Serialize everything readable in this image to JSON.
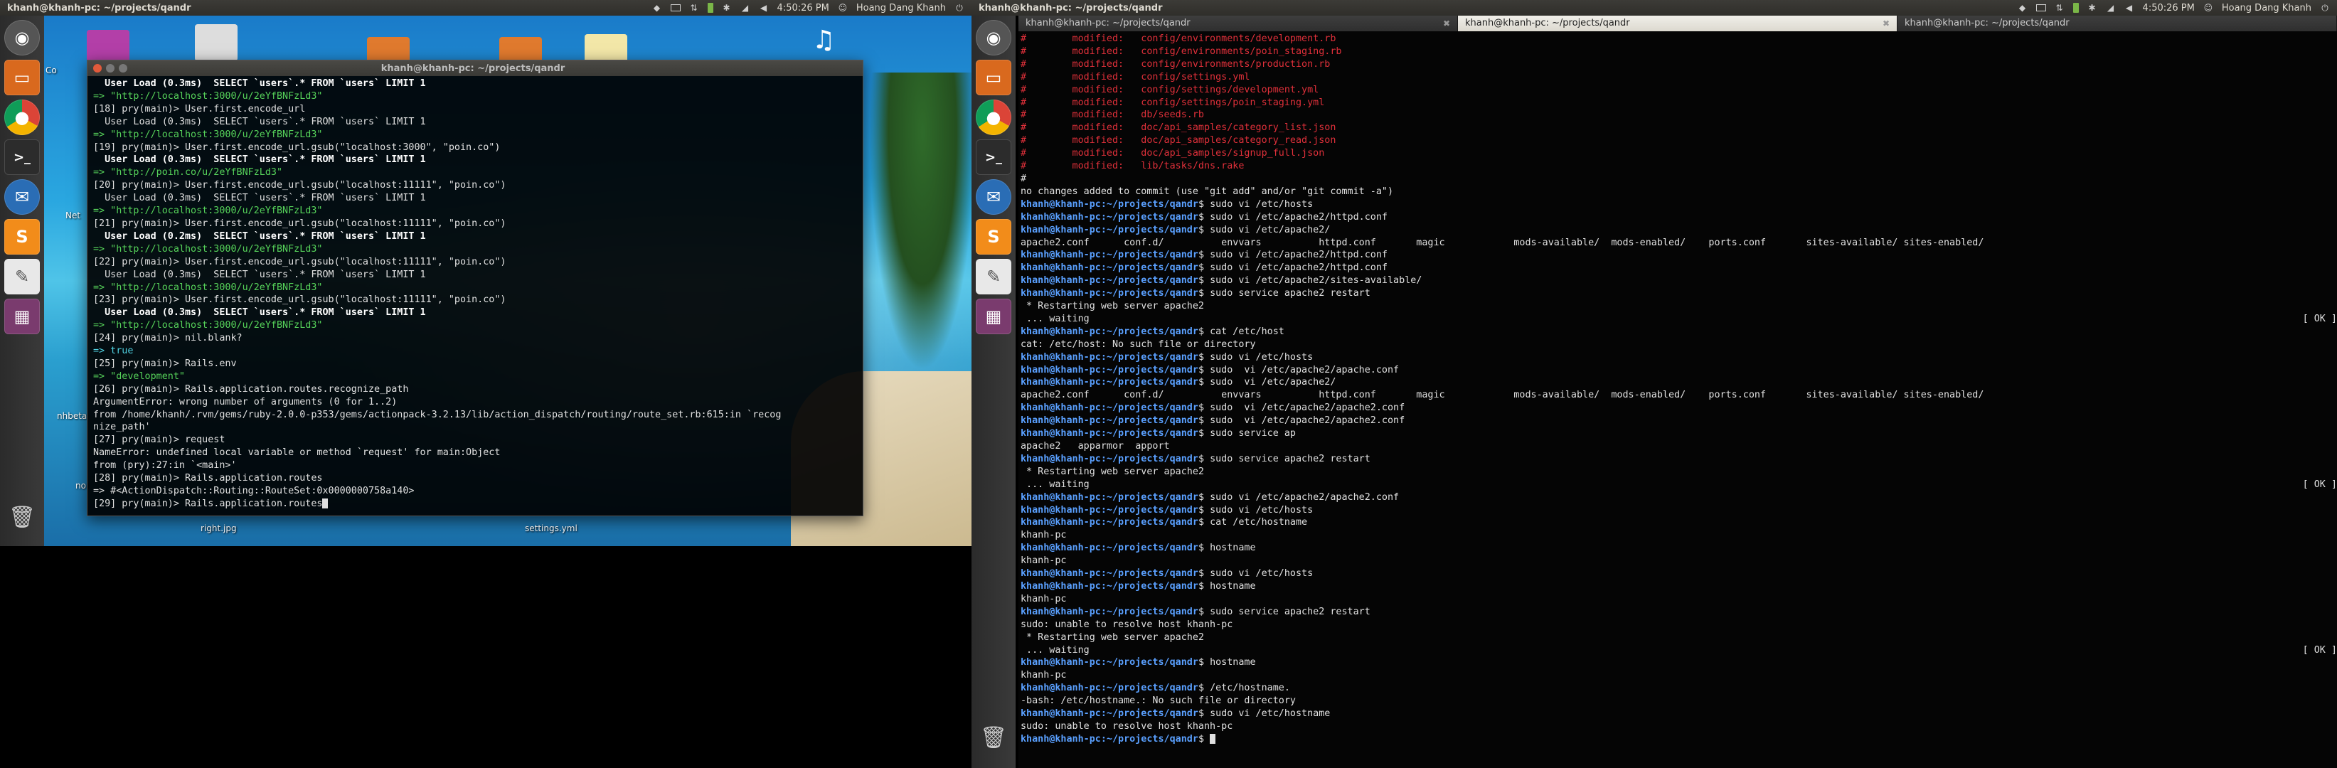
{
  "left_panel": {
    "title": "khanh@khanh-pc: ~/projects/qandr",
    "time": "4:50:26 PM",
    "user": "Hoang Dang Khanh"
  },
  "right_panel": {
    "title": "khanh@khanh-pc: ~/projects/qandr",
    "time": "4:50:26 PM",
    "user": "Hoang Dang Khanh"
  },
  "left_window": {
    "title": "khanh@khanh-pc: ~/projects/qandr"
  },
  "desktop_labels": {
    "right_jpg": "right.jpg",
    "settings_yml": "settings.yml",
    "nhbeta": "nhbeta",
    "nol": "nol",
    "net": "Net",
    "co": "Co"
  },
  "right_tabs": [
    {
      "label": "khanh@khanh-pc: ~/projects/qandr",
      "active": false
    },
    {
      "label": "khanh@khanh-pc: ~/projects/qandr",
      "active": true
    },
    {
      "label": "khanh@khanh-pc: ~/projects/qandr",
      "active": false
    }
  ],
  "left_terminal_lines": [
    [
      "b",
      "  User Load (0.3ms)  SELECT `users`.* FROM `users` LIMIT 1"
    ],
    [
      "g",
      "=> \"http://localhost:3000/u/2eYfBNFzLd3\""
    ],
    [
      "t",
      "[18] pry(main)> User.first.encode_url"
    ],
    [
      "t",
      "  User Load (0.3ms)  SELECT `users`.* FROM `users` LIMIT 1"
    ],
    [
      "g",
      "=> \"http://localhost:3000/u/2eYfBNFzLd3\""
    ],
    [
      "t",
      "[19] pry(main)> User.first.encode_url.gsub(\"localhost:3000\", \"poin.co\")"
    ],
    [
      "b",
      "  User Load (0.3ms)  SELECT `users`.* FROM `users` LIMIT 1"
    ],
    [
      "g",
      "=> \"http://poin.co/u/2eYfBNFzLd3\""
    ],
    [
      "t",
      "[20] pry(main)> User.first.encode_url.gsub(\"localhost:11111\", \"poin.co\")"
    ],
    [
      "t",
      "  User Load (0.3ms)  SELECT `users`.* FROM `users` LIMIT 1"
    ],
    [
      "g",
      "=> \"http://localhost:3000/u/2eYfBNFzLd3\""
    ],
    [
      "t",
      "[21] pry(main)> User.first.encode_url.gsub(\"localhost:11111\", \"poin.co\")"
    ],
    [
      "b",
      "  User Load (0.2ms)  SELECT `users`.* FROM `users` LIMIT 1"
    ],
    [
      "g",
      "=> \"http://localhost:3000/u/2eYfBNFzLd3\""
    ],
    [
      "t",
      "[22] pry(main)> User.first.encode_url.gsub(\"localhost:11111\", \"poin.co\")"
    ],
    [
      "t",
      "  User Load (0.3ms)  SELECT `users`.* FROM `users` LIMIT 1"
    ],
    [
      "g",
      "=> \"http://localhost:3000/u/2eYfBNFzLd3\""
    ],
    [
      "t",
      "[23] pry(main)> User.first.encode_url.gsub(\"localhost:11111\", \"poin.co\")"
    ],
    [
      "b",
      "  User Load (0.3ms)  SELECT `users`.* FROM `users` LIMIT 1"
    ],
    [
      "g",
      "=> \"http://localhost:3000/u/2eYfBNFzLd3\""
    ],
    [
      "t",
      "[24] pry(main)> nil.blank?"
    ],
    [
      "c",
      "=> true"
    ],
    [
      "t",
      "[25] pry(main)> Rails.env"
    ],
    [
      "g",
      "=> \"development\""
    ],
    [
      "t",
      "[26] pry(main)> Rails.application.routes.recognize_path"
    ],
    [
      "t",
      "ArgumentError: wrong number of arguments (0 for 1..2)"
    ],
    [
      "t",
      "from /home/khanh/.rvm/gems/ruby-2.0.0-p353/gems/actionpack-3.2.13/lib/action_dispatch/routing/route_set.rb:615:in `recog"
    ],
    [
      "t",
      "nize_path'"
    ],
    [
      "t",
      "[27] pry(main)> request"
    ],
    [
      "t",
      "NameError: undefined local variable or method `request' for main:Object"
    ],
    [
      "t",
      "from (pry):27:in `<main>'"
    ],
    [
      "t",
      "[28] pry(main)> Rails.application.routes"
    ],
    [
      "t",
      "=> #<ActionDispatch::Routing::RouteSet:0x0000000758a140>"
    ],
    [
      "t",
      "[29] pry(main)> Rails.application.routes"
    ]
  ],
  "right_terminal_lines": [
    [
      "m",
      "#\tmodified:   config/environments/development.rb"
    ],
    [
      "m",
      "#\tmodified:   config/environments/poin_staging.rb"
    ],
    [
      "m",
      "#\tmodified:   config/environments/production.rb"
    ],
    [
      "m",
      "#\tmodified:   config/settings.yml"
    ],
    [
      "m",
      "#\tmodified:   config/settings/development.yml"
    ],
    [
      "m",
      "#\tmodified:   config/settings/poin_staging.yml"
    ],
    [
      "m",
      "#\tmodified:   db/seeds.rb"
    ],
    [
      "m",
      "#\tmodified:   doc/api_samples/category_list.json"
    ],
    [
      "m",
      "#\tmodified:   doc/api_samples/category_read.json"
    ],
    [
      "m",
      "#\tmodified:   doc/api_samples/signup_full.json"
    ],
    [
      "m",
      "#\tmodified:   lib/tasks/dns.rake"
    ],
    [
      "t",
      "#"
    ],
    [
      "t",
      "no changes added to commit (use \"git add\" and/or \"git commit -a\")"
    ],
    [
      "p",
      "sudo vi /etc/hosts"
    ],
    [
      "p",
      "sudo vi /etc/apache2/httpd.conf"
    ],
    [
      "p",
      "sudo vi /etc/apache2/"
    ],
    [
      "t",
      "apache2.conf      conf.d/          envvars          httpd.conf       magic            mods-available/  mods-enabled/    ports.conf       sites-available/ sites-enabled/"
    ],
    [
      "p",
      "sudo vi /etc/apache2/httpd.conf"
    ],
    [
      "p",
      "sudo vi /etc/apache2/httpd.conf"
    ],
    [
      "p",
      "sudo vi /etc/apache2/sites-available/"
    ],
    [
      "p",
      "sudo service apache2 restart"
    ],
    [
      "t",
      " * Restarting web server apache2"
    ],
    [
      "o",
      " ... waiting "
    ],
    [
      "p",
      "cat /etc/host"
    ],
    [
      "t",
      "cat: /etc/host: No such file or directory"
    ],
    [
      "p",
      "sudo vi /etc/hosts"
    ],
    [
      "p",
      "sudo  vi /etc/apache2/apache.conf"
    ],
    [
      "p",
      "sudo  vi /etc/apache2/"
    ],
    [
      "t",
      "apache2.conf      conf.d/          envvars          httpd.conf       magic            mods-available/  mods-enabled/    ports.conf       sites-available/ sites-enabled/"
    ],
    [
      "p",
      "sudo  vi /etc/apache2/apache2.conf"
    ],
    [
      "p",
      "sudo  vi /etc/apache2/apache2.conf"
    ],
    [
      "p",
      "sudo service ap"
    ],
    [
      "t",
      "apache2   apparmor  apport"
    ],
    [
      "p",
      "sudo service apache2 restart"
    ],
    [
      "t",
      " * Restarting web server apache2"
    ],
    [
      "o",
      " ... waiting "
    ],
    [
      "p",
      "sudo vi /etc/apache2/apache2.conf"
    ],
    [
      "p",
      "sudo vi /etc/hosts"
    ],
    [
      "p",
      "cat /etc/hostname"
    ],
    [
      "t",
      "khanh-pc"
    ],
    [
      "p",
      "hostname"
    ],
    [
      "t",
      "khanh-pc"
    ],
    [
      "p",
      "sudo vi /etc/hosts"
    ],
    [
      "p",
      "hostname"
    ],
    [
      "t",
      "khanh-pc"
    ],
    [
      "p",
      "sudo service apache2 restart"
    ],
    [
      "t",
      "sudo: unable to resolve host khanh-pc"
    ],
    [
      "t",
      " * Restarting web server apache2"
    ],
    [
      "o",
      " ... waiting "
    ],
    [
      "p",
      "hostname"
    ],
    [
      "t",
      "khanh-pc"
    ],
    [
      "p",
      "/etc/hostname."
    ],
    [
      "t",
      "-bash: /etc/hostname.: No such file or directory"
    ],
    [
      "p",
      "sudo vi /etc/hostname"
    ],
    [
      "t",
      "sudo: unable to resolve host khanh-pc"
    ],
    [
      "c",
      ""
    ]
  ],
  "prompt": {
    "user_host": "khanh@khanh-pc",
    "path": ":~/projects/qandr",
    "symbol": "$ "
  },
  "ok_label": "[ OK ]",
  "colors": {
    "panel": "#3c3b37",
    "prompt": "#5aa0ff",
    "modified": "#e0303a",
    "string": "#56d35a"
  }
}
